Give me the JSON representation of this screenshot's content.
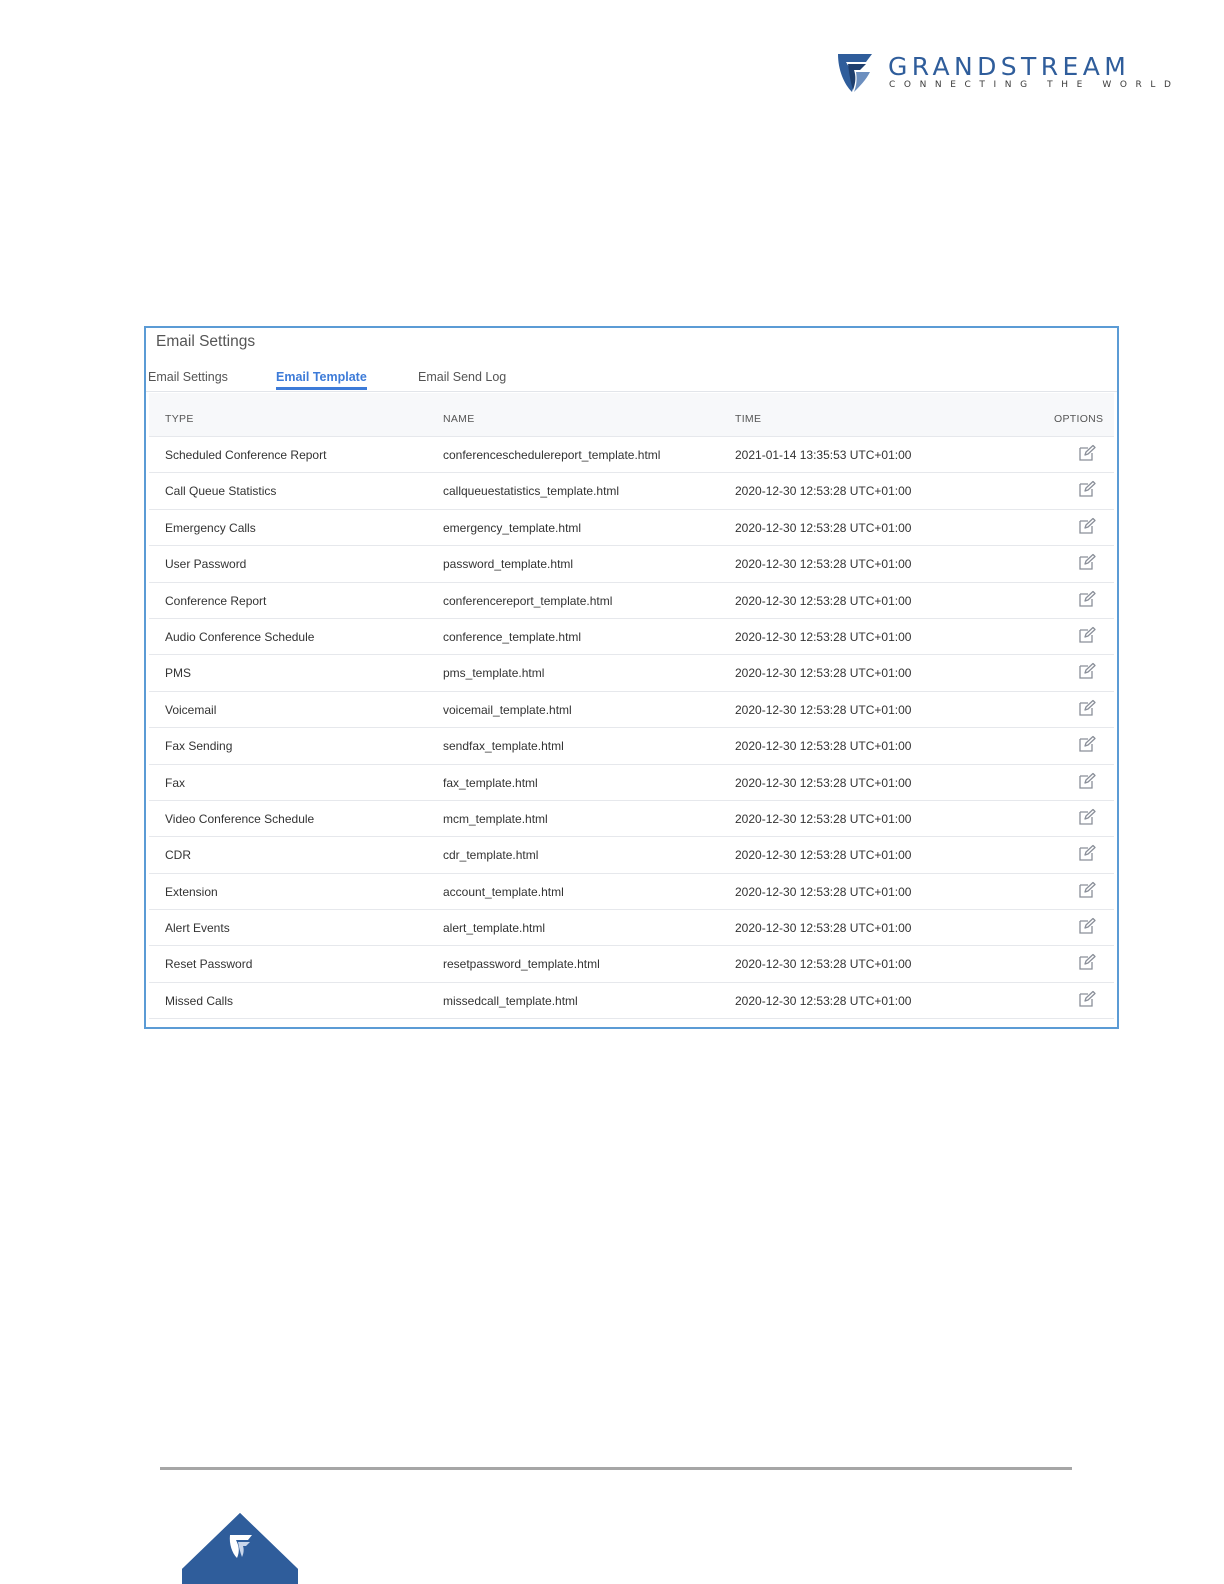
{
  "brand": {
    "name": "GRANDSTREAM",
    "tagline": "CONNECTING THE WORLD",
    "color": "#2f5d9b"
  },
  "panel": {
    "title": "Email Settings",
    "tabs": [
      {
        "label": "Email Settings",
        "active": false
      },
      {
        "label": "Email Template",
        "active": true
      },
      {
        "label": "Email Send Log",
        "active": false
      }
    ],
    "accent": "#3d7bd8"
  },
  "table": {
    "headers": {
      "type": "TYPE",
      "name": "NAME",
      "time": "TIME",
      "options": "OPTIONS"
    },
    "rows": [
      {
        "type": "Scheduled Conference Report",
        "name": "conferenceschedulereport_template.html",
        "time": "2021-01-14 13:35:53 UTC+01:00"
      },
      {
        "type": "Call Queue Statistics",
        "name": "callqueuestatistics_template.html",
        "time": "2020-12-30 12:53:28 UTC+01:00"
      },
      {
        "type": "Emergency Calls",
        "name": "emergency_template.html",
        "time": "2020-12-30 12:53:28 UTC+01:00"
      },
      {
        "type": "User Password",
        "name": "password_template.html",
        "time": "2020-12-30 12:53:28 UTC+01:00"
      },
      {
        "type": "Conference Report",
        "name": "conferencereport_template.html",
        "time": "2020-12-30 12:53:28 UTC+01:00"
      },
      {
        "type": "Audio Conference Schedule",
        "name": "conference_template.html",
        "time": "2020-12-30 12:53:28 UTC+01:00"
      },
      {
        "type": "PMS",
        "name": "pms_template.html",
        "time": "2020-12-30 12:53:28 UTC+01:00"
      },
      {
        "type": "Voicemail",
        "name": "voicemail_template.html",
        "time": "2020-12-30 12:53:28 UTC+01:00"
      },
      {
        "type": "Fax Sending",
        "name": "sendfax_template.html",
        "time": "2020-12-30 12:53:28 UTC+01:00"
      },
      {
        "type": "Fax",
        "name": "fax_template.html",
        "time": "2020-12-30 12:53:28 UTC+01:00"
      },
      {
        "type": "Video Conference Schedule",
        "name": "mcm_template.html",
        "time": "2020-12-30 12:53:28 UTC+01:00"
      },
      {
        "type": "CDR",
        "name": "cdr_template.html",
        "time": "2020-12-30 12:53:28 UTC+01:00"
      },
      {
        "type": "Extension",
        "name": "account_template.html",
        "time": "2020-12-30 12:53:28 UTC+01:00"
      },
      {
        "type": "Alert Events",
        "name": "alert_template.html",
        "time": "2020-12-30 12:53:28 UTC+01:00"
      },
      {
        "type": "Reset Password",
        "name": "resetpassword_template.html",
        "time": "2020-12-30 12:53:28 UTC+01:00"
      },
      {
        "type": "Missed Calls",
        "name": "missedcall_template.html",
        "time": "2020-12-30 12:53:28 UTC+01:00"
      }
    ],
    "row_icon": "edit-icon"
  }
}
